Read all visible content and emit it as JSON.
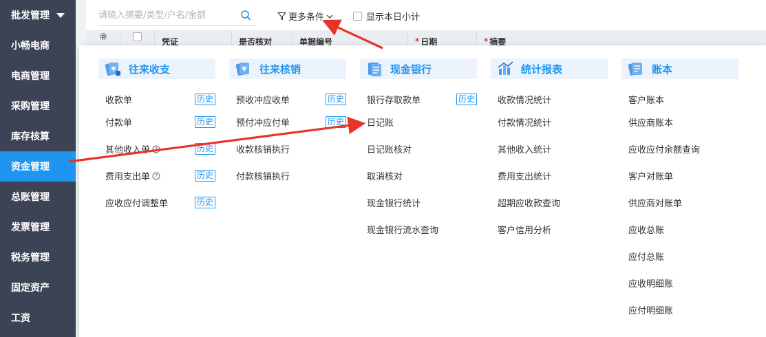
{
  "sidebar": {
    "items": [
      {
        "label": "批发管理",
        "has_caret": true
      },
      {
        "label": "小畅电商"
      },
      {
        "label": "电商管理"
      },
      {
        "label": "采购管理"
      },
      {
        "label": "库存核算"
      },
      {
        "label": "资金管理",
        "active": true
      },
      {
        "label": "总账管理"
      },
      {
        "label": "发票管理"
      },
      {
        "label": "税务管理"
      },
      {
        "label": "固定资产"
      },
      {
        "label": "工资"
      }
    ]
  },
  "toolbar": {
    "search_placeholder": "请输入摘要/类型/户名/金额",
    "more_conditions": "更多条件",
    "show_day_subtotal": "显示本日小计"
  },
  "table": {
    "headers": [
      "凭证",
      "是否核对",
      "单据编号",
      "日期",
      "摘要"
    ],
    "required_marker": "*"
  },
  "menu": {
    "history_label": "历史",
    "columns": [
      {
        "title": "往来收支",
        "icon": "receipt-icon",
        "items": [
          {
            "label": "收款单",
            "history": true
          },
          {
            "label": "付款单",
            "history": true
          },
          {
            "label": "其他收入单",
            "history": true,
            "help": true
          },
          {
            "label": "费用支出单",
            "history": true,
            "help": true
          },
          {
            "label": "应收应付调整单",
            "history": true
          }
        ]
      },
      {
        "title": "往来核销",
        "icon": "writeoff-icon",
        "items": [
          {
            "label": "预收冲应收单",
            "history": true
          },
          {
            "label": "预付冲应付单",
            "history": true
          },
          {
            "label": "收款核销执行"
          },
          {
            "label": "付款核销执行"
          }
        ]
      },
      {
        "title": "现金银行",
        "icon": "cash-bank-icon",
        "items": [
          {
            "label": "银行存取款单",
            "history": true
          },
          {
            "label": "日记账"
          },
          {
            "label": "日记账核对"
          },
          {
            "label": "取消核对"
          },
          {
            "label": "现金银行统计"
          },
          {
            "label": "现金银行流水查询"
          }
        ]
      },
      {
        "title": "统计报表",
        "icon": "report-chart-icon",
        "items": [
          {
            "label": "收款情况统计"
          },
          {
            "label": "付款情况统计"
          },
          {
            "label": "其他收入统计"
          },
          {
            "label": "费用支出统计"
          },
          {
            "label": "超期应收款查询"
          },
          {
            "label": "客户信用分析"
          }
        ]
      },
      {
        "title": "账本",
        "icon": "ledger-book-icon",
        "items": [
          {
            "label": "客户账本"
          },
          {
            "label": "供应商账本"
          },
          {
            "label": "应收应付余额查询"
          },
          {
            "label": "客户对账单"
          },
          {
            "label": "供应商对账单"
          },
          {
            "label": "应收总账"
          },
          {
            "label": "应付总账"
          },
          {
            "label": "应收明细账"
          },
          {
            "label": "应付明细账"
          }
        ]
      }
    ]
  },
  "colors": {
    "sidebar_bg": "#3c4354",
    "accent": "#1e96f0",
    "header_bg": "#edf3fc",
    "arrow": "#e8332a"
  }
}
